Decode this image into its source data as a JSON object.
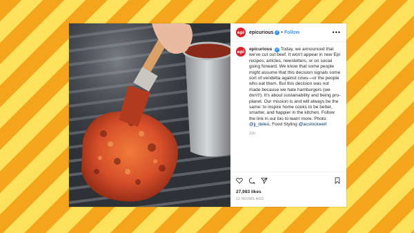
{
  "post": {
    "username": "epicurious",
    "avatar_text": "epi",
    "follow_label": "Follow",
    "separator": "•",
    "more_label": "•••",
    "caption_username": "epicurious",
    "caption_text_1": "Today, we announced that we've cut out beef. It won't appear in new Epi recipes, articles, newsletters, or on social going forward. We know that some people might assume that this decision signals some sort of vendetta against cows—or the people who eat them. But this decision was not made because we hate hamburgers (we don't!). It's about sustainability and being pro-planet. Our mission is and will always be the same: to inspire home cooks to be better, smarter, and happier in the kitchen. Follow the link in our bio to learn more. Photo:",
    "mention_1": "@jj_deleo",
    "caption_text_2": ", Food Styling",
    "mention_2": "@acstockwell",
    "caption_time": "11h",
    "likes": "27,983 likes",
    "posted_ago": "11 HOURS AGO"
  },
  "colors": {
    "brand": "#d8232a",
    "link": "#3897f0",
    "stripe_a": "#f5a51c",
    "stripe_b": "#fde15a"
  },
  "icons": [
    "verified-badge-icon",
    "heart-icon",
    "comment-icon",
    "share-icon",
    "bookmark-icon",
    "more-options-icon"
  ]
}
